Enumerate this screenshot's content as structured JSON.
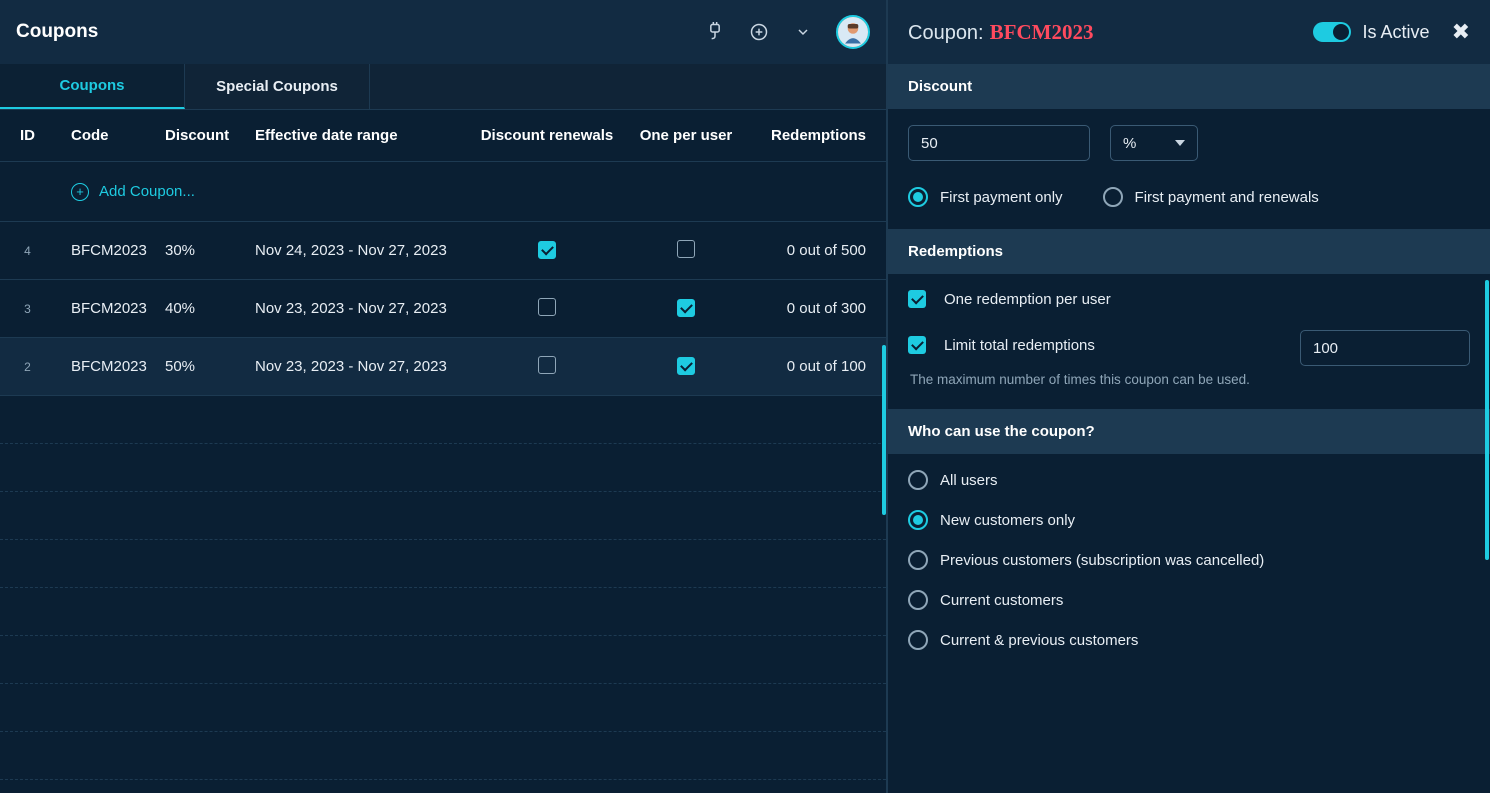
{
  "page_title": "Coupons",
  "tabs": {
    "coupons": "Coupons",
    "special": "Special Coupons"
  },
  "table": {
    "headers": {
      "id": "ID",
      "code": "Code",
      "discount": "Discount",
      "date_range": "Effective date range",
      "renewals": "Discount renewals",
      "one_per_user": "One per user",
      "redemptions": "Redemptions"
    },
    "add_link": "Add Coupon...",
    "rows": [
      {
        "id": "4",
        "code": "BFCM2023",
        "discount": "30%",
        "date_range": "Nov 24, 2023 - Nov 27, 2023",
        "renewals": true,
        "one_per_user": false,
        "redemptions": "0 out of 500"
      },
      {
        "id": "3",
        "code": "BFCM2023",
        "discount": "40%",
        "date_range": "Nov 23, 2023 - Nov 27, 2023",
        "renewals": false,
        "one_per_user": true,
        "redemptions": "0 out of 300"
      },
      {
        "id": "2",
        "code": "BFCM2023",
        "discount": "50%",
        "date_range": "Nov 23, 2023 - Nov 27, 2023",
        "renewals": false,
        "one_per_user": true,
        "redemptions": "0 out of 100"
      }
    ]
  },
  "editor": {
    "title_prefix": "Coupon:",
    "coupon_code": "BFCM2023",
    "active_label": "Is Active",
    "discount": {
      "section": "Discount",
      "value": "50",
      "unit": "%",
      "radio_first_only": "First payment only",
      "radio_first_and_renewals": "First payment and renewals"
    },
    "redemptions": {
      "section": "Redemptions",
      "one_per_user": "One redemption per user",
      "limit_total": "Limit total redemptions",
      "limit_value": "100",
      "help": "The maximum number of times this coupon can be used."
    },
    "who": {
      "section": "Who can use the coupon?",
      "all": "All users",
      "new": "New customers only",
      "prev": "Previous customers (subscription was cancelled)",
      "current": "Current customers",
      "both": "Current & previous customers"
    }
  }
}
